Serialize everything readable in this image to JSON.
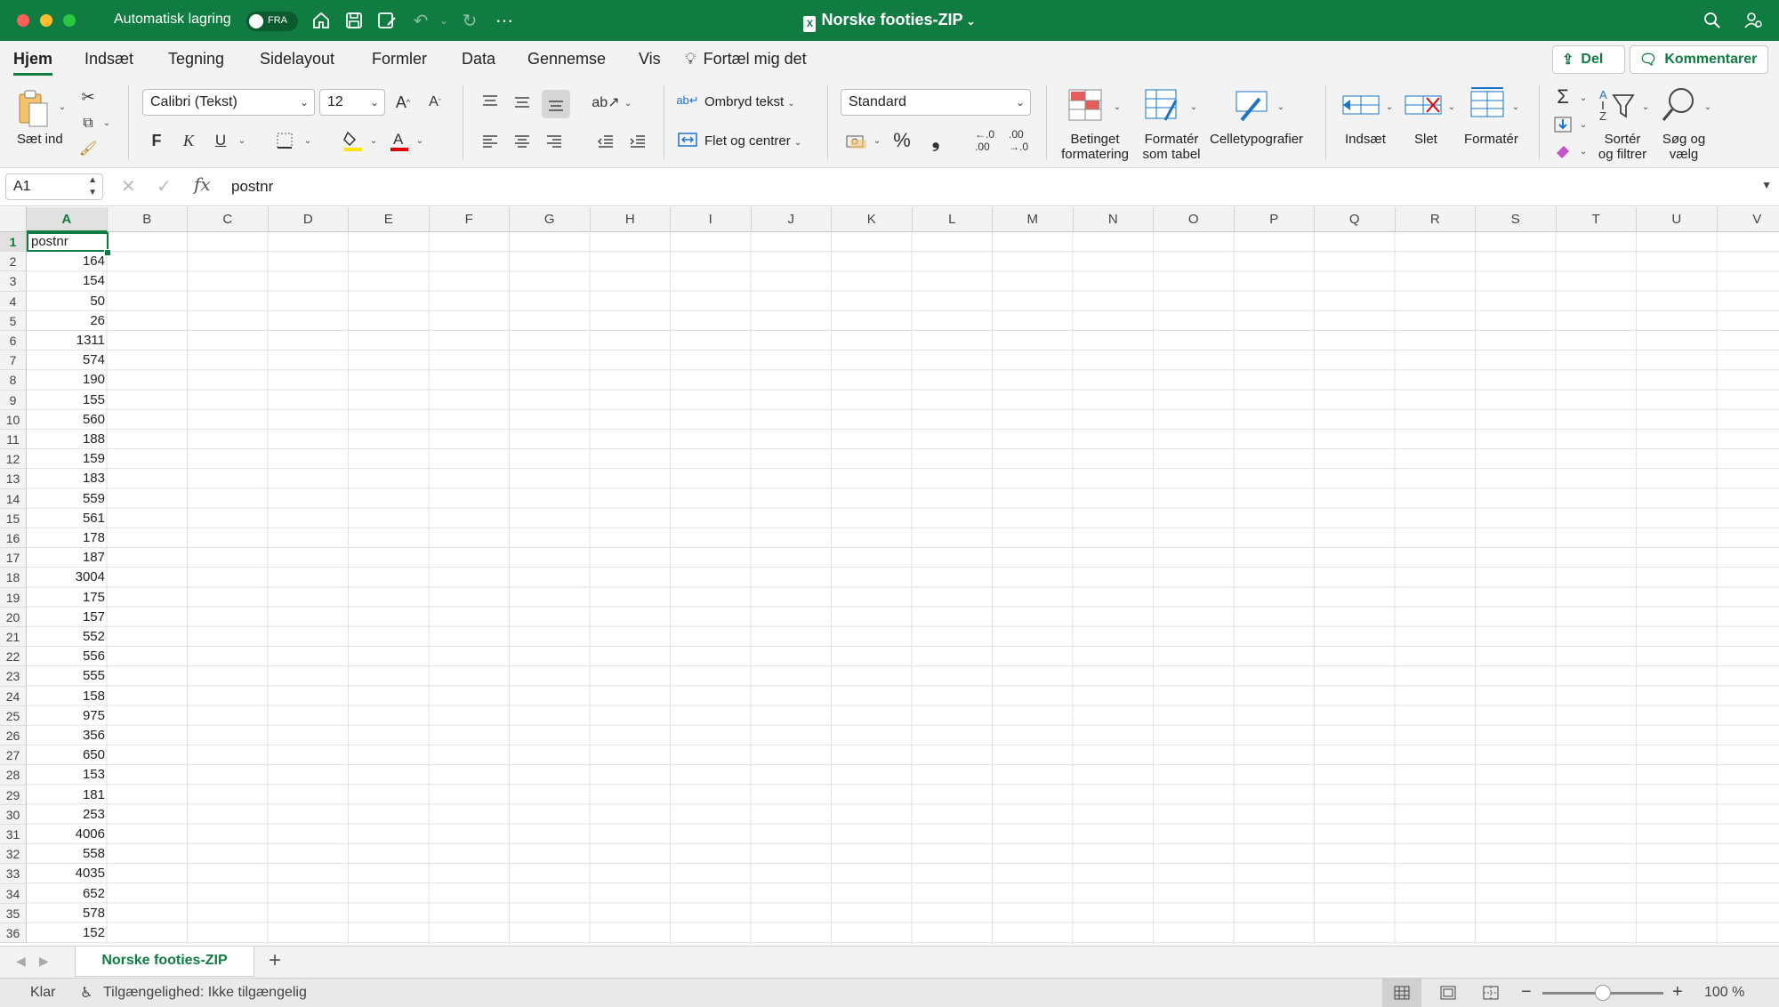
{
  "titlebar": {
    "autosave_label": "Automatisk lagring",
    "autosave_state": "FRA",
    "doc_title": "Norske footies-ZIP",
    "colors": {
      "accent": "#107c41"
    }
  },
  "menu": {
    "tabs": [
      "Hjem",
      "Indsæt",
      "Tegning",
      "Sidelayout",
      "Formler",
      "Data",
      "Gennemse",
      "Vis"
    ],
    "tell_me": "Fortæl mig det",
    "share": "Del",
    "comments": "Kommentarer"
  },
  "ribbon": {
    "paste": "Sæt ind",
    "font_name": "Calibri (Tekst)",
    "font_size": "12",
    "bold": "F",
    "italic": "K",
    "underline": "U",
    "wrap_text": "Ombryd tekst",
    "merge_center": "Flet og centrer",
    "number_format": "Standard",
    "cond_format_1": "Betinget",
    "cond_format_2": "formatering",
    "format_table_1": "Formatér",
    "format_table_2": "som tabel",
    "cell_styles": "Celletypografier",
    "insert": "Indsæt",
    "delete": "Slet",
    "format": "Formatér",
    "sort_filter_1": "Sortér",
    "sort_filter_2": "og filtrer",
    "find_select_1": "Søg og",
    "find_select_2": "vælg"
  },
  "formula_bar": {
    "name_box": "A1",
    "content": "postnr"
  },
  "grid": {
    "columns": [
      "A",
      "B",
      "C",
      "D",
      "E",
      "F",
      "G",
      "H",
      "I",
      "J",
      "K",
      "L",
      "M",
      "N",
      "O",
      "P",
      "Q",
      "R",
      "S",
      "T",
      "U",
      "V"
    ],
    "rows": [
      "1",
      "2",
      "3",
      "4",
      "5",
      "6",
      "7",
      "8",
      "9",
      "10",
      "11",
      "12",
      "13",
      "14",
      "15",
      "16",
      "17",
      "18",
      "19",
      "20",
      "21",
      "22",
      "23",
      "24",
      "25",
      "26",
      "27",
      "28",
      "29",
      "30",
      "31",
      "32",
      "33",
      "34",
      "35",
      "36"
    ],
    "col_a_values": [
      "postnr",
      "164",
      "154",
      "50",
      "26",
      "1311",
      "574",
      "190",
      "155",
      "560",
      "188",
      "159",
      "183",
      "559",
      "561",
      "178",
      "187",
      "3004",
      "175",
      "157",
      "552",
      "556",
      "555",
      "158",
      "975",
      "356",
      "650",
      "153",
      "181",
      "253",
      "4006",
      "558",
      "4035",
      "652",
      "578",
      "152"
    ]
  },
  "sheets": {
    "active": "Norske footies-ZIP"
  },
  "status": {
    "ready": "Klar",
    "accessibility": "Tilgængelighed: Ikke tilgængelig",
    "zoom": "100 %",
    "zoom_level": 0.5
  }
}
